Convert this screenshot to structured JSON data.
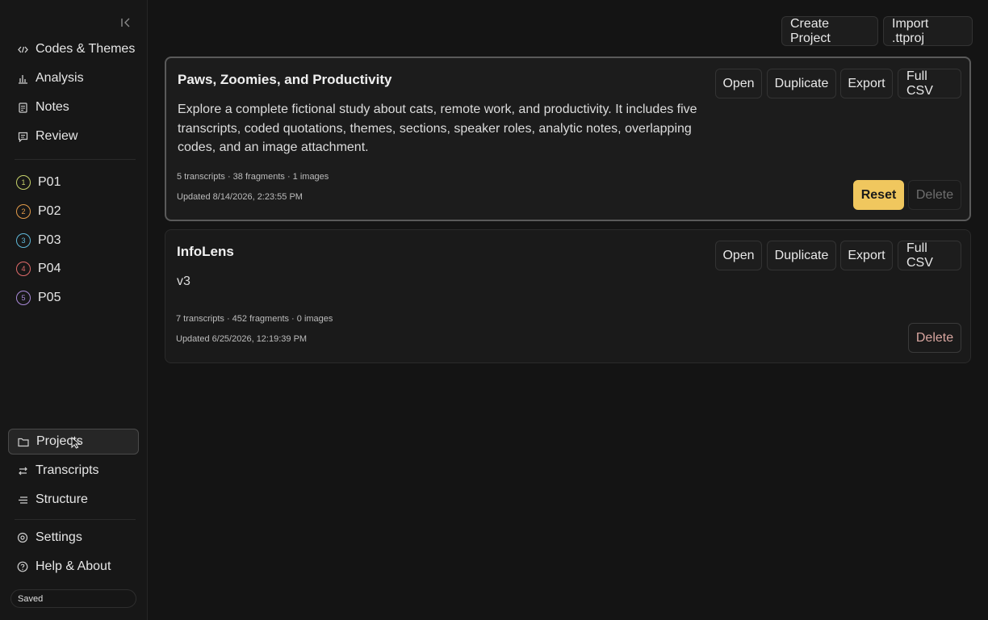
{
  "sidebar": {
    "collapse_icon": "collapse-left-icon",
    "top_items": [
      {
        "label": "Codes & Themes",
        "icon": "code-icon"
      },
      {
        "label": "Analysis",
        "icon": "bar-chart-icon"
      },
      {
        "label": "Notes",
        "icon": "note-icon"
      },
      {
        "label": "Review",
        "icon": "review-icon"
      }
    ],
    "transcripts": [
      {
        "num": "1",
        "label": "P01",
        "color": "#c7d36a"
      },
      {
        "num": "2",
        "label": "P02",
        "color": "#e39b4a"
      },
      {
        "num": "3",
        "label": "P03",
        "color": "#5fb8d9"
      },
      {
        "num": "4",
        "label": "P04",
        "color": "#e06a6a"
      },
      {
        "num": "5",
        "label": "P05",
        "color": "#a98ad9"
      }
    ],
    "bottom_items": [
      {
        "label": "Projects",
        "icon": "folder-icon",
        "active": true
      },
      {
        "label": "Transcripts",
        "icon": "swap-icon"
      },
      {
        "label": "Structure",
        "icon": "list-icon"
      }
    ],
    "footer_items": [
      {
        "label": "Settings",
        "icon": "gear-icon"
      },
      {
        "label": "Help & About",
        "icon": "help-icon"
      }
    ],
    "status": "Saved"
  },
  "header": {
    "create_label": "Create Project",
    "import_label": "Import .ttproj"
  },
  "projects": [
    {
      "title": "Paws, Zoomies, and Productivity",
      "description": "Explore a complete fictional study about cats, remote work, and productivity. It includes five transcripts, coded quotations, themes, sections, speaker roles, analytic notes, overlapping codes, and an image attachment.",
      "stats": "5 transcripts · 38 fragments · 1 images",
      "updated": "Updated 8/14/2026, 2:23:55 PM",
      "open_label": "Open",
      "duplicate_label": "Duplicate",
      "export_label": "Export",
      "csv_label": "Full CSV",
      "reset_label": "Reset",
      "delete_label": "Delete"
    },
    {
      "title": "InfoLens",
      "description": "v3",
      "stats": "7 transcripts · 452 fragments · 0 images",
      "updated": "Updated 6/25/2026, 12:19:39 PM",
      "open_label": "Open",
      "duplicate_label": "Duplicate",
      "export_label": "Export",
      "csv_label": "Full CSV",
      "delete_label": "Delete"
    }
  ]
}
